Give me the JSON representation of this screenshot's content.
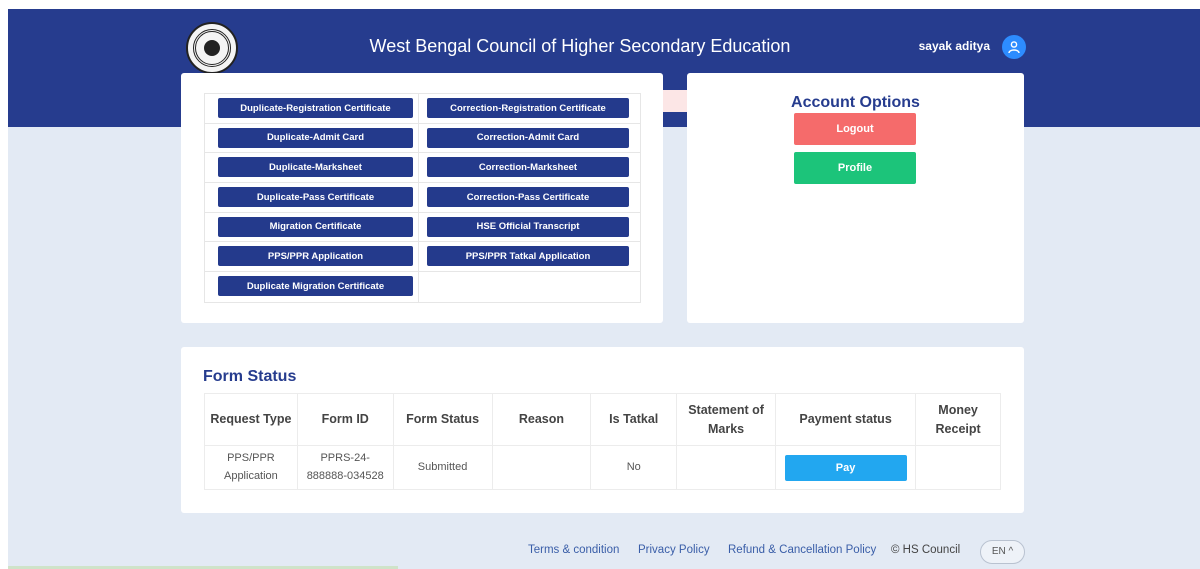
{
  "header": {
    "title": "West Bengal Council of Higher Secondary Education",
    "user_name": "sayak aditya"
  },
  "services": {
    "left": [
      "Duplicate-Registration Certificate",
      "Duplicate-Admit Card",
      "Duplicate-Marksheet",
      "Duplicate-Pass Certificate",
      "Migration Certificate",
      "PPS/PPR Application",
      "Duplicate Migration Certificate"
    ],
    "right": [
      "Correction-Registration Certificate",
      "Correction-Admit Card",
      "Correction-Marksheet",
      "Correction-Pass Certificate",
      "HSE Official Transcript",
      "PPS/PPR Tatkal Application"
    ]
  },
  "account": {
    "title": "Account Options",
    "logout_label": "Logout",
    "profile_label": "Profile"
  },
  "form_status": {
    "title": "Form Status",
    "headers": [
      "Request Type",
      "Form ID",
      "Form Status",
      "Reason",
      "Is Tatkal",
      "Statement of Marks",
      "Payment status",
      "Money Receipt"
    ],
    "rows": [
      {
        "request_type": "PPS/PPR Application",
        "form_id": "PPRS-24-888888-034528",
        "form_status": "Submitted",
        "reason": "",
        "is_tatkal": "No",
        "statement_of_marks": "",
        "payment_label": "Pay",
        "money_receipt": ""
      }
    ]
  },
  "footer": {
    "terms": "Terms & condition",
    "privacy": "Privacy Policy",
    "refund": "Refund & Cancellation Policy",
    "copyright": "© HS Council",
    "language": "EN ^"
  },
  "colors": {
    "header": "#263c8e",
    "logout": "#f56b6b",
    "profile": "#1cc47a",
    "pay": "#22a7f0"
  }
}
